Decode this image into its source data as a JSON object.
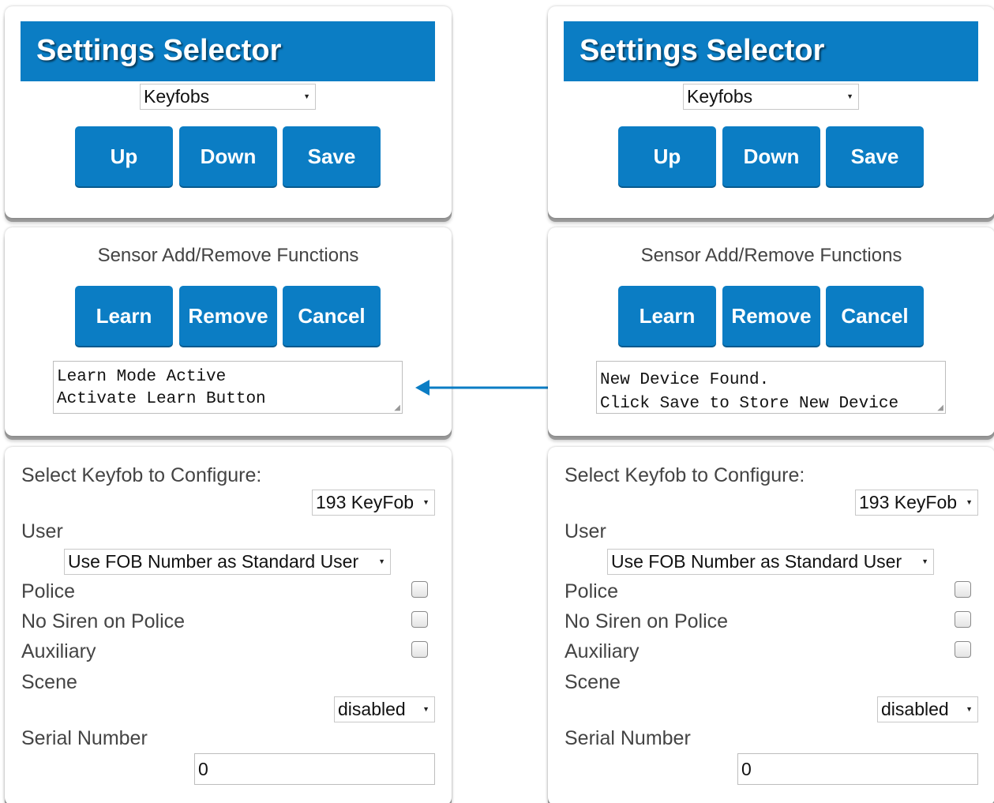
{
  "panels": [
    {
      "settings": {
        "title": "Settings Selector",
        "selector_value": "Keyfobs",
        "buttons": {
          "up": "Up",
          "down": "Down",
          "save": "Save"
        }
      },
      "sensor": {
        "title": "Sensor Add/Remove Functions",
        "buttons": {
          "learn": "Learn",
          "remove": "Remove",
          "cancel": "Cancel"
        },
        "status_lines": [
          "Learn Mode Active",
          "Activate Learn Button"
        ]
      },
      "config": {
        "select_label": "Select Keyfob to Configure:",
        "keyfob_value": "193 KeyFob",
        "user_label": "User",
        "user_value": "Use FOB Number as Standard User",
        "police_label": "Police",
        "no_siren_label": "No Siren on Police",
        "auxiliary_label": "Auxiliary",
        "scene_label": "Scene",
        "scene_value": "disabled",
        "serial_label": "Serial Number",
        "serial_value": "0"
      }
    },
    {
      "settings": {
        "title": "Settings Selector",
        "selector_value": "Keyfobs",
        "buttons": {
          "up": "Up",
          "down": "Down",
          "save": "Save"
        }
      },
      "sensor": {
        "title": "Sensor Add/Remove Functions",
        "buttons": {
          "learn": "Learn",
          "remove": "Remove",
          "cancel": "Cancel"
        },
        "status_lines": [
          "New Device Found.",
          "Click Save to Store New Device"
        ]
      },
      "config": {
        "select_label": "Select Keyfob to Configure:",
        "keyfob_value": "193 KeyFob",
        "user_label": "User",
        "user_value": "Use FOB Number as Standard User",
        "police_label": "Police",
        "no_siren_label": "No Siren on Police",
        "auxiliary_label": "Auxiliary",
        "scene_label": "Scene",
        "scene_value": "disabled",
        "serial_label": "Serial Number",
        "serial_value": "0"
      }
    }
  ],
  "colors": {
    "accent": "#0b7dc4",
    "arrow": "#0b7dc4"
  }
}
